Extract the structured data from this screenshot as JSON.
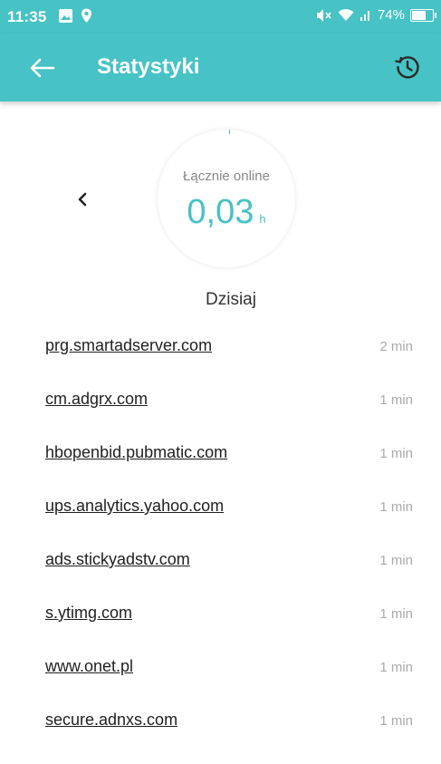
{
  "status_bar": {
    "time": "11:35",
    "battery": "74%",
    "battery_level": 0.74,
    "icons": [
      "image-icon",
      "location-icon",
      "mute-icon",
      "wifi-icon",
      "signal-icon",
      "battery-icon"
    ]
  },
  "app_bar": {
    "title": "Statystyki",
    "background": "#47c2c5",
    "icons": [
      "back-arrow-icon",
      "history-icon"
    ]
  },
  "summary": {
    "label": "Łącznie online",
    "value": "0,03",
    "unit": "h",
    "accent": "#47c2c5"
  },
  "period": {
    "label": "Dzisiaj"
  },
  "sites": [
    {
      "domain": "prg.smartadserver.com",
      "time": "2 min"
    },
    {
      "domain": "cm.adgrx.com",
      "time": "1 min"
    },
    {
      "domain": "hbopenbid.pubmatic.com",
      "time": "1 min"
    },
    {
      "domain": "ups.analytics.yahoo.com",
      "time": "1 min"
    },
    {
      "domain": "ads.stickyadstv.com",
      "time": "1 min"
    },
    {
      "domain": "s.ytimg.com",
      "time": "1 min"
    },
    {
      "domain": "www.onet.pl",
      "time": "1 min"
    },
    {
      "domain": "secure.adnxs.com",
      "time": "1 min"
    }
  ]
}
